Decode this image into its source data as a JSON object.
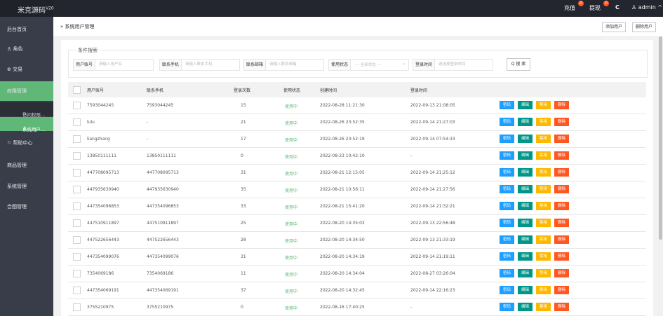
{
  "app": {
    "title": "米克源码",
    "version": "V20"
  },
  "topbar": {
    "recharge": {
      "label": "充值",
      "badge": "0"
    },
    "withdraw": {
      "label": "提现",
      "badge": "0"
    },
    "refresh_icon": "C",
    "user": "admin",
    "user_caret": "^"
  },
  "sidebar": {
    "items": [
      {
        "label": "后台首页"
      },
      {
        "label": "角色",
        "icon": "person-icon",
        "glyph": "♙"
      },
      {
        "label": "交易",
        "icon": "globe-icon",
        "glyph": "⊕"
      },
      {
        "label": "权限管理"
      },
      {
        "label": "帮助中心",
        "icon": "help-icon",
        "glyph": "⚐"
      },
      {
        "label": "商品管理"
      },
      {
        "label": "系统管理"
      },
      {
        "label": "合图管理"
      }
    ],
    "subitems": [
      {
        "label": "访问权限...",
        "glyph": "⊙"
      },
      {
        "label": "系统用户...",
        "glyph": "♙"
      }
    ]
  },
  "breadcrumb": {
    "separator": "»",
    "label": "系统用户管理"
  },
  "header_buttons": {
    "add": "添加用户",
    "delete": "删除用户"
  },
  "search": {
    "legend": "条件搜索",
    "fields": [
      {
        "label": "用户账号",
        "placeholder": "请输入用户名"
      },
      {
        "label": "联系手机",
        "placeholder": "请输入联系手机"
      },
      {
        "label": "联系邮箱",
        "placeholder": "请输入联系邮箱"
      },
      {
        "label": "使用状态",
        "value": "--- 全部状态 ---"
      },
      {
        "label": "登录时间",
        "placeholder": "请选择登录时间"
      }
    ],
    "button": "Q 搜 索"
  },
  "table": {
    "headers": [
      "用户账号",
      "联系手机",
      "登录次数",
      "使用状态",
      "创建时间",
      "登录时间"
    ],
    "actions": [
      "密码",
      "编辑",
      "禁用",
      "删除"
    ],
    "rows": [
      {
        "account": "7593044245",
        "phone": "7593044245",
        "logins": "15",
        "status": "使用中",
        "created": "2022-08-28 11:21:30",
        "last_login": "2022-09-13 21:08:05"
      },
      {
        "account": "lulu",
        "phone": "-",
        "logins": "21",
        "status": "使用中",
        "created": "2022-08-26 23:52:35",
        "last_login": "2022-09-14 21:27:03"
      },
      {
        "account": "liangzhang",
        "phone": "-",
        "logins": "17",
        "status": "使用中",
        "created": "2022-08-26 23:52:19",
        "last_login": "2022-09-14 07:54:33"
      },
      {
        "account": "13850111111",
        "phone": "13850111111",
        "logins": "0",
        "status": "使用中",
        "created": "2022-08-23 10:42:10",
        "last_login": "-"
      },
      {
        "account": "447708095713",
        "phone": "447708095713",
        "logins": "31",
        "status": "使用中",
        "created": "2022-08-21 12:15:05",
        "last_login": "2022-09-14 21:25:12"
      },
      {
        "account": "447935630940",
        "phone": "447935630940",
        "logins": "35",
        "status": "使用中",
        "created": "2022-08-21 10:56:11",
        "last_login": "2022-09-14 21:27:56"
      },
      {
        "account": "447354096853",
        "phone": "447354096853",
        "logins": "33",
        "status": "使用中",
        "created": "2022-08-21 15:41:20",
        "last_login": "2022-09-14 21:32:21"
      },
      {
        "account": "447510911897",
        "phone": "447510911897",
        "logins": "25",
        "status": "使用中",
        "created": "2022-08-20 14:35:03",
        "last_login": "2022-09-13 22:56:48"
      },
      {
        "account": "447522656443",
        "phone": "447522656443",
        "logins": "28",
        "status": "使用中",
        "created": "2022-08-20 14:34:50",
        "last_login": "2022-09-13 21:33:19"
      },
      {
        "account": "447354099076",
        "phone": "447354099076",
        "logins": "31",
        "status": "使用中",
        "created": "2022-08-20 14:34:19",
        "last_login": "2022-09-14 21:19:11"
      },
      {
        "account": "7354069186",
        "phone": "7354069186",
        "logins": "11",
        "status": "使用中",
        "created": "2022-08-20 14:34:04",
        "last_login": "2022-08-27 03:26:04"
      },
      {
        "account": "447354069191",
        "phone": "447354069191",
        "logins": "37",
        "status": "使用中",
        "created": "2022-08-20 14:32:45",
        "last_login": "2022-09-14 22:16:23"
      },
      {
        "account": "3755210975",
        "phone": "3755210975",
        "logins": "0",
        "status": "使用中",
        "created": "2022-08-16 17:40:25",
        "last_login": "-"
      }
    ]
  },
  "colors": {
    "topbar": "#23262e",
    "sidebar": "#393d49",
    "active": "#5fb878",
    "password": "#1e9fff",
    "edit": "#009688",
    "disable": "#ffb800",
    "delete": "#ff5722"
  }
}
